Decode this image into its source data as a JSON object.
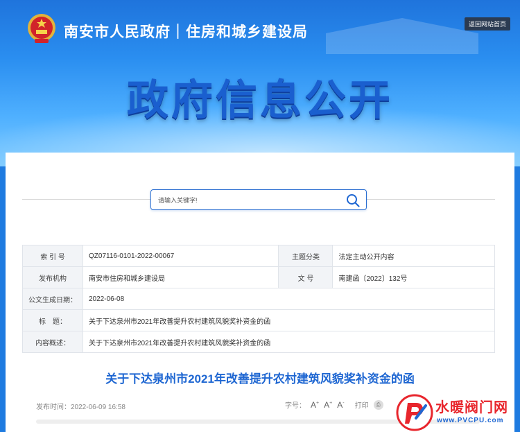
{
  "header": {
    "title": "南安市人民政府｜住房和城乡建设局",
    "home_label": "返回网站首页",
    "banner": "政府信息公开"
  },
  "search": {
    "placeholder": "请输入关键字!"
  },
  "meta": {
    "index_label": "索 引 号",
    "index_value": "QZ07116-0101-2022-00067",
    "category_label": "主题分类",
    "category_value": "法定主动公开内容",
    "publisher_label": "发布机构",
    "publisher_value": "南安市住房和城乡建设局",
    "docno_label": "文 号",
    "docno_value": "南建函〔2022〕132号",
    "date_label": "公文生成日期：",
    "date_value": "2022-06-08",
    "title_label": "标　题：",
    "title_value": "关于下达泉州市2021年改善提升农村建筑风貌奖补资金的函",
    "summary_label": "内容概述：",
    "summary_value": "关于下达泉州市2021年改善提升农村建筑风貌奖补资金的函"
  },
  "article": {
    "title": "关于下达泉州市2021年改善提升农村建筑风貌奖补资金的函",
    "publish_time": "发布时间：2022-06-09 16:58",
    "font_size_label": "字号：",
    "font_large": "A",
    "font_medium": "A",
    "font_small": "A",
    "print_label": "打印"
  },
  "watermark": {
    "brand": "水暖阀门网",
    "url": "www.PVCPU.com"
  },
  "colors": {
    "accent": "#1f67d2",
    "brand_red": "#e8262d"
  }
}
